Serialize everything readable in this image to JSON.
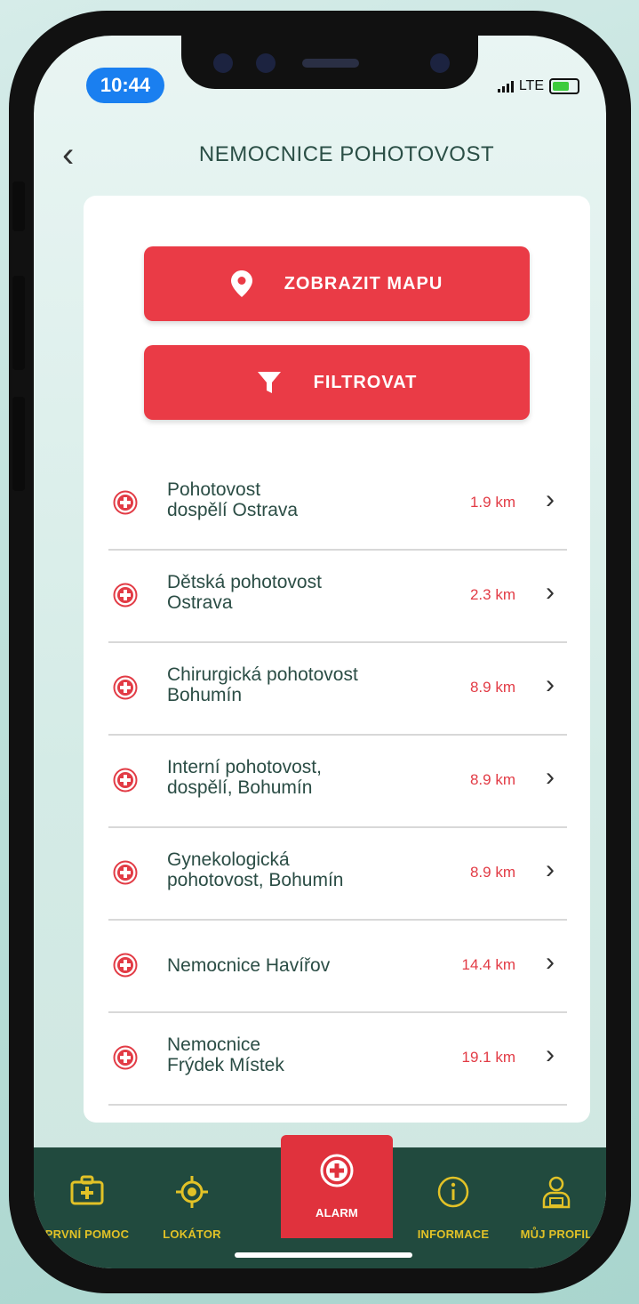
{
  "status": {
    "time": "10:44",
    "network": "LTE"
  },
  "header": {
    "title": "NEMOCNICE POHOTOVOST"
  },
  "actions": {
    "map_label": "ZOBRAZIT MAPU",
    "filter_label": "FILTROVAT"
  },
  "list": [
    {
      "name_line1": "Pohotovost",
      "name_line2": "dospělí Ostrava",
      "distance": "1.9 km"
    },
    {
      "name_line1": "Dětská pohotovost",
      "name_line2": "Ostrava",
      "distance": "2.3 km"
    },
    {
      "name_line1": "Chirurgická pohotovost",
      "name_line2": "Bohumín",
      "distance": "8.9 km"
    },
    {
      "name_line1": "Interní pohotovost,",
      "name_line2": "dospělí,  Bohumín",
      "distance": "8.9 km"
    },
    {
      "name_line1": "Gynekologická",
      "name_line2": "pohotovost, Bohumín",
      "distance": "8.9 km"
    },
    {
      "name_line1": "Nemocnice Havířov",
      "name_line2": "",
      "distance": "14.4 km"
    },
    {
      "name_line1": "Nemocnice",
      "name_line2": "Frýdek Místek",
      "distance": "19.1 km"
    }
  ],
  "tabs": [
    {
      "label": "PRVNÍ POMOC",
      "icon": "first-aid-kit-icon"
    },
    {
      "label": "LOKÁTOR",
      "icon": "locator-icon"
    },
    {
      "label": "ALARM",
      "icon": "alarm-plus-icon",
      "active": true
    },
    {
      "label": "INFORMACE",
      "icon": "info-icon"
    },
    {
      "label": "MŮJ PROFIL",
      "icon": "profile-icon"
    }
  ],
  "colors": {
    "accent": "#ea3b46",
    "tabbar": "#214a3e",
    "tab_text": "#e2c227",
    "distance": "#e23b45"
  }
}
